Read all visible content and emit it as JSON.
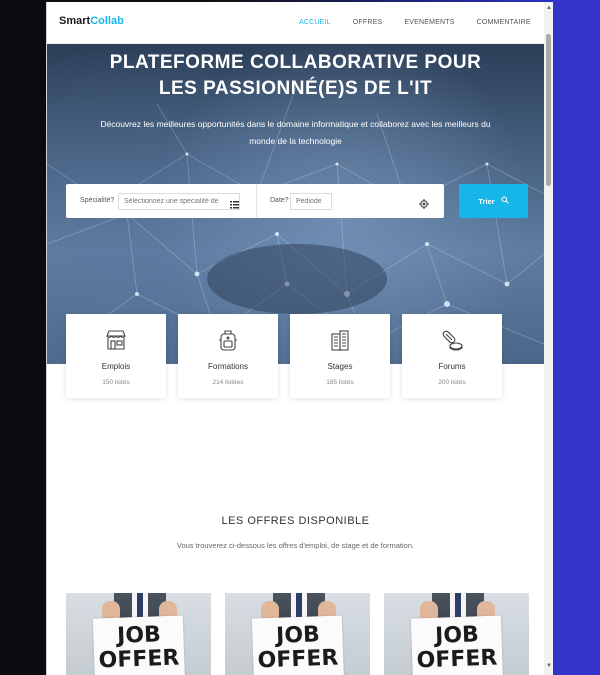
{
  "brand": {
    "part1": "Smart",
    "part2": "Collab"
  },
  "nav": {
    "items": [
      {
        "label": "ACCUEIL",
        "active": true
      },
      {
        "label": "OFFRES",
        "active": false
      },
      {
        "label": "EVENEMENTS",
        "active": false
      },
      {
        "label": "COMMENTAIRE",
        "active": false
      }
    ]
  },
  "hero": {
    "title_line1": "PLATEFORME COLLABORATIVE POUR",
    "title_line2": "LES PASSIONNÉ(E)S DE L'IT",
    "subtitle_line1": "Découvrez les meilleures opportunités dans le domaine informatique et collaborez avec les meilleurs du",
    "subtitle_line2": "monde de la technologie"
  },
  "search": {
    "speciality_label": "Spécialité?",
    "speciality_placeholder": "Sélectionnez une spécialité de",
    "date_label": "Date?",
    "date_placeholder": "Pédiode",
    "button_label": "Trier"
  },
  "categories": [
    {
      "name": "Emplois",
      "count": "150 listés",
      "icon": "store-icon"
    },
    {
      "name": "Formations",
      "count": "214 listées",
      "icon": "backpack-icon"
    },
    {
      "name": "Stages",
      "count": "185 listés",
      "icon": "building-icon"
    },
    {
      "name": "Forums",
      "count": "200 listés",
      "icon": "pills-icon"
    }
  ],
  "offers": {
    "title": "LES OFFRES DISPONIBLE",
    "subtitle": "Vous trouverez ci-dessous les offres d'emploi, de stage et de formation.",
    "cards": [
      {
        "line1": "JOB",
        "line2": "OFFER"
      },
      {
        "line1": "JOB",
        "line2": "OFFER"
      },
      {
        "line1": "JOB",
        "line2": "OFFER"
      }
    ]
  },
  "colors": {
    "accent": "#16b6e8",
    "hero_dark": "#2c3f58",
    "right_bg": "#3534c9"
  }
}
